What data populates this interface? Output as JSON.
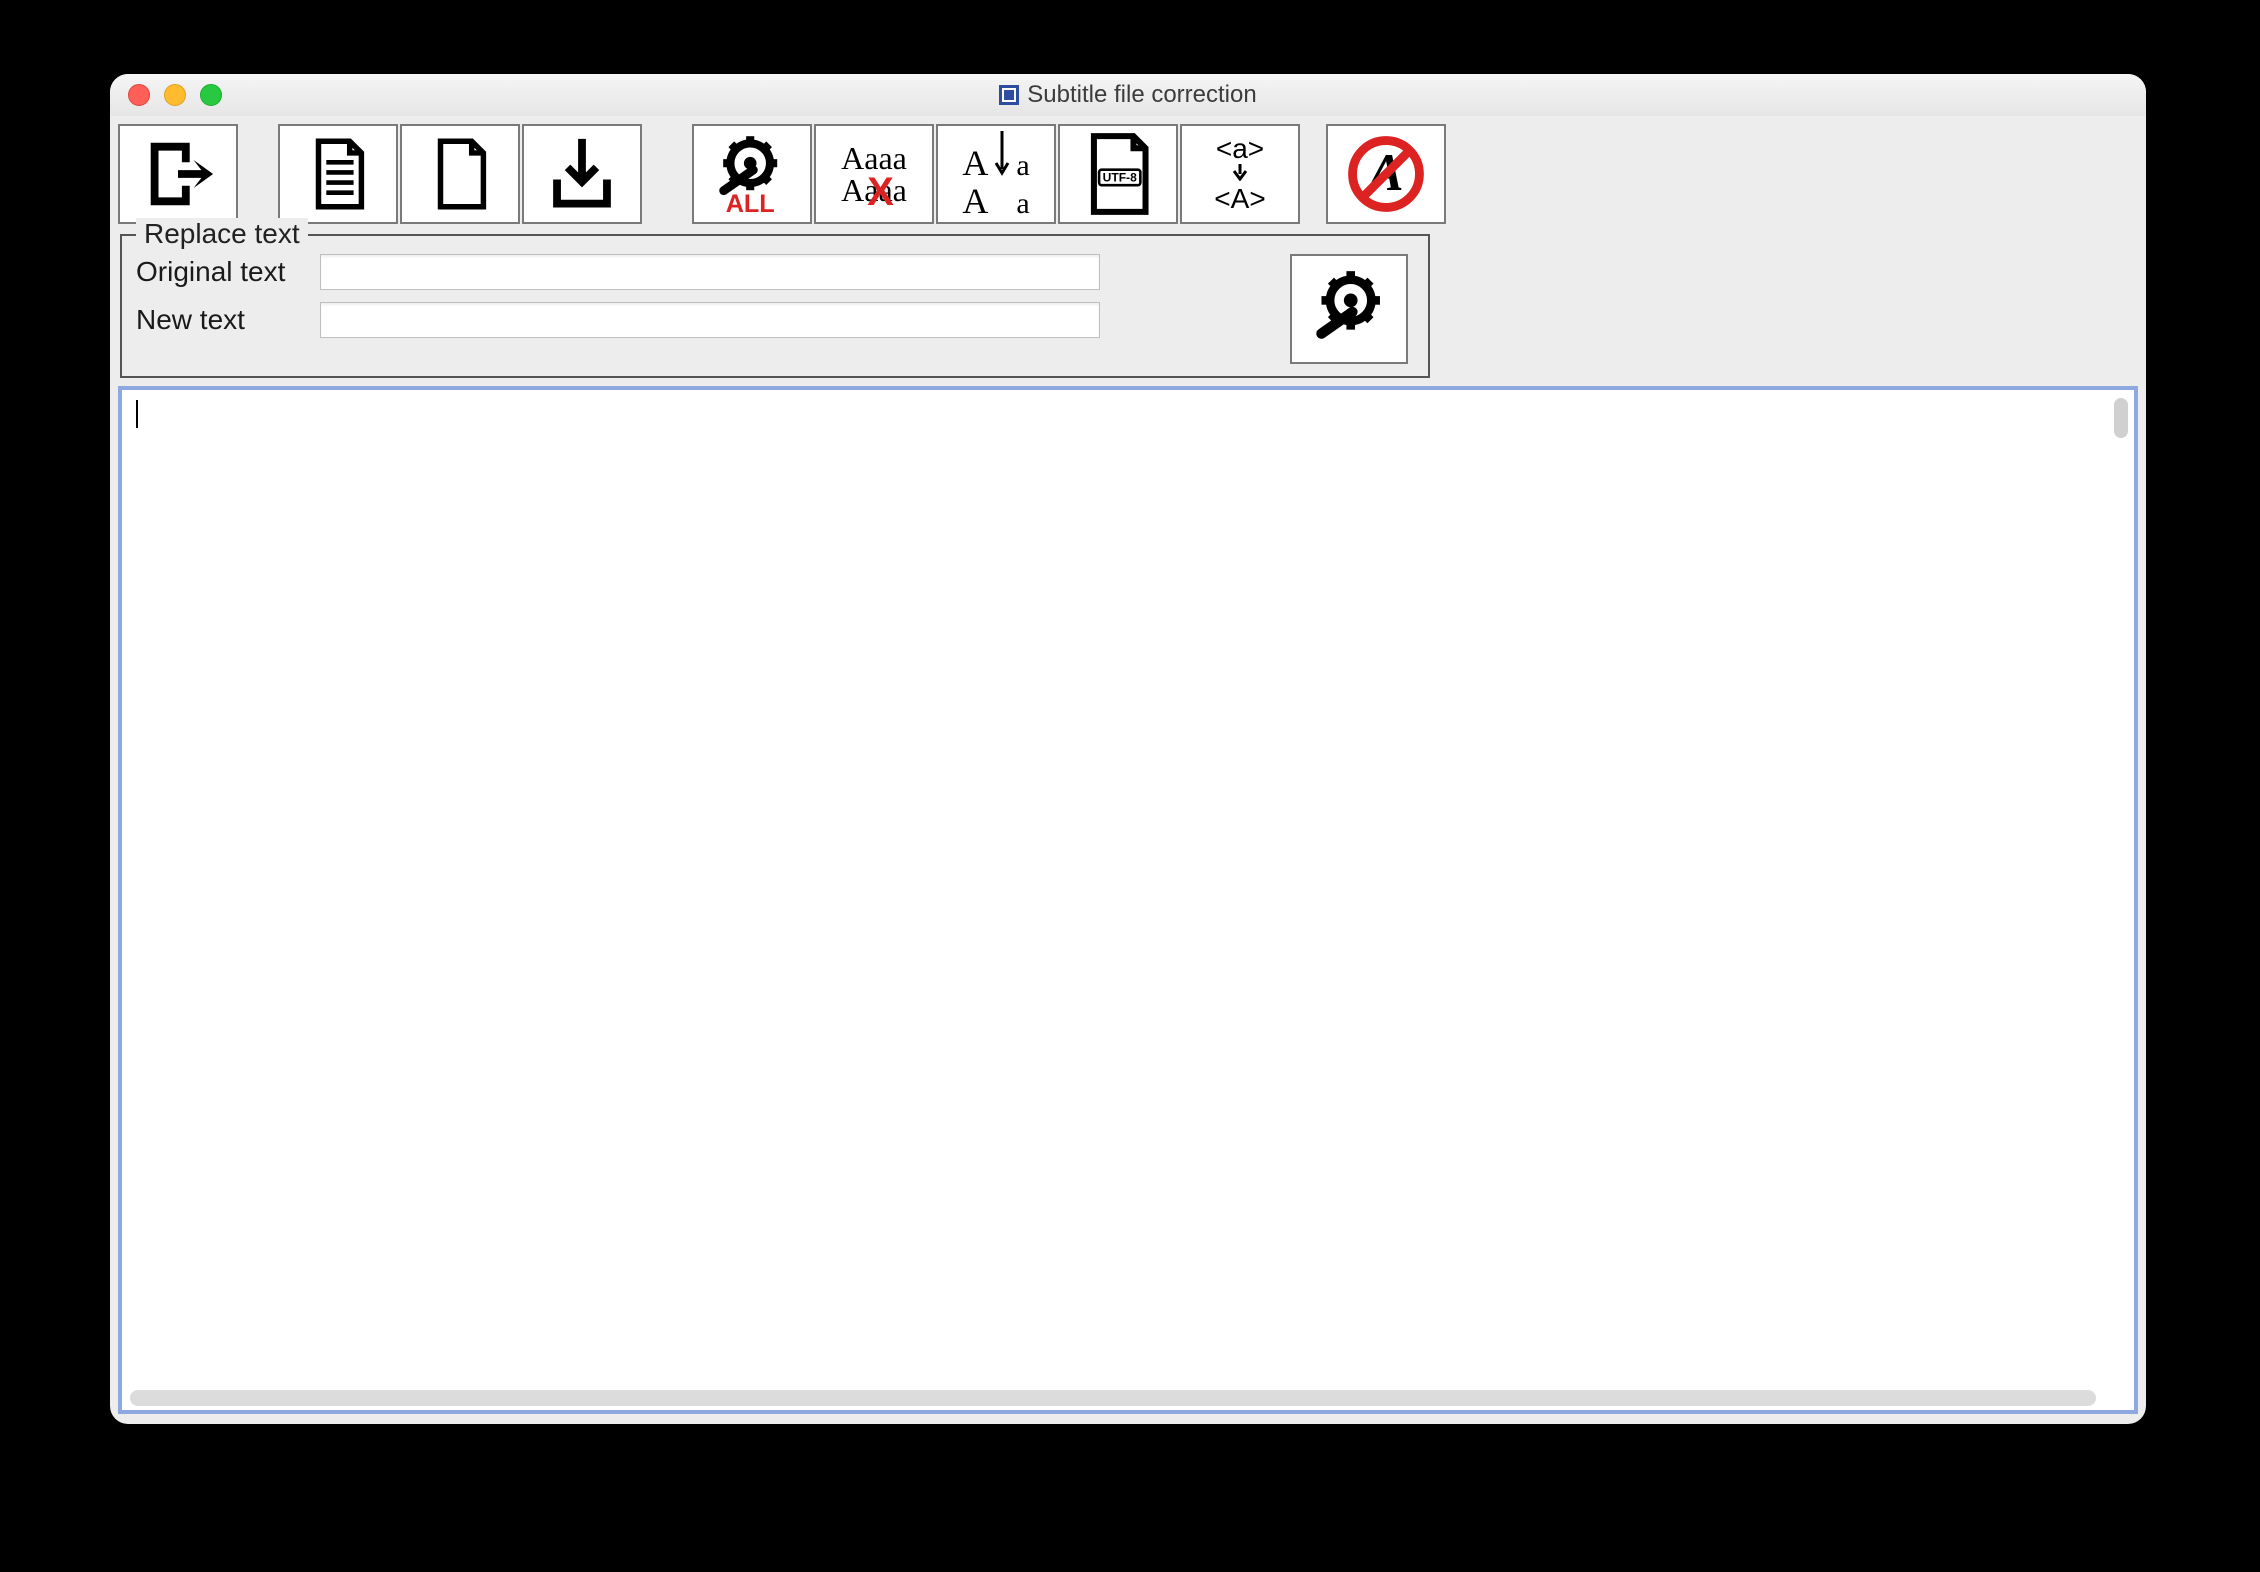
{
  "window": {
    "title": "Subtitle file correction"
  },
  "toolbar": {
    "buttons": [
      {
        "name": "exit-button",
        "icon": "exit-icon"
      },
      {
        "name": "open-file-button",
        "icon": "document-lines-icon"
      },
      {
        "name": "new-file-button",
        "icon": "blank-document-icon"
      },
      {
        "name": "save-download-button",
        "icon": "download-icon"
      },
      {
        "name": "fix-all-button",
        "icon": "gear-wrench-all-icon",
        "badge": "ALL"
      },
      {
        "name": "remove-dup-lines-button",
        "icon": "remove-duplicate-text-icon",
        "top_text": "Aaaa",
        "bottom_text": "Aaaa"
      },
      {
        "name": "change-case-button",
        "icon": "case-convert-icon",
        "top_left": "A",
        "top_right": "a",
        "bottom_left": "A",
        "bottom_right": "a"
      },
      {
        "name": "utf8-encode-button",
        "icon": "utf8-file-icon",
        "badge": "UTF-8"
      },
      {
        "name": "tag-case-button",
        "icon": "tag-case-icon",
        "top_text": "<a>",
        "bottom_text": "<A>"
      },
      {
        "name": "disable-styling-button",
        "icon": "no-style-icon"
      }
    ]
  },
  "replace": {
    "group_label": "Replace text",
    "original_label": "Original text",
    "new_label": "New text",
    "original_value": "",
    "new_value": "",
    "action_icon": "gear-wrench-icon"
  },
  "editor": {
    "content": ""
  },
  "colors": {
    "focus_border": "#8da9df",
    "red_accent": "#d22",
    "window_bg": "#ededed"
  }
}
